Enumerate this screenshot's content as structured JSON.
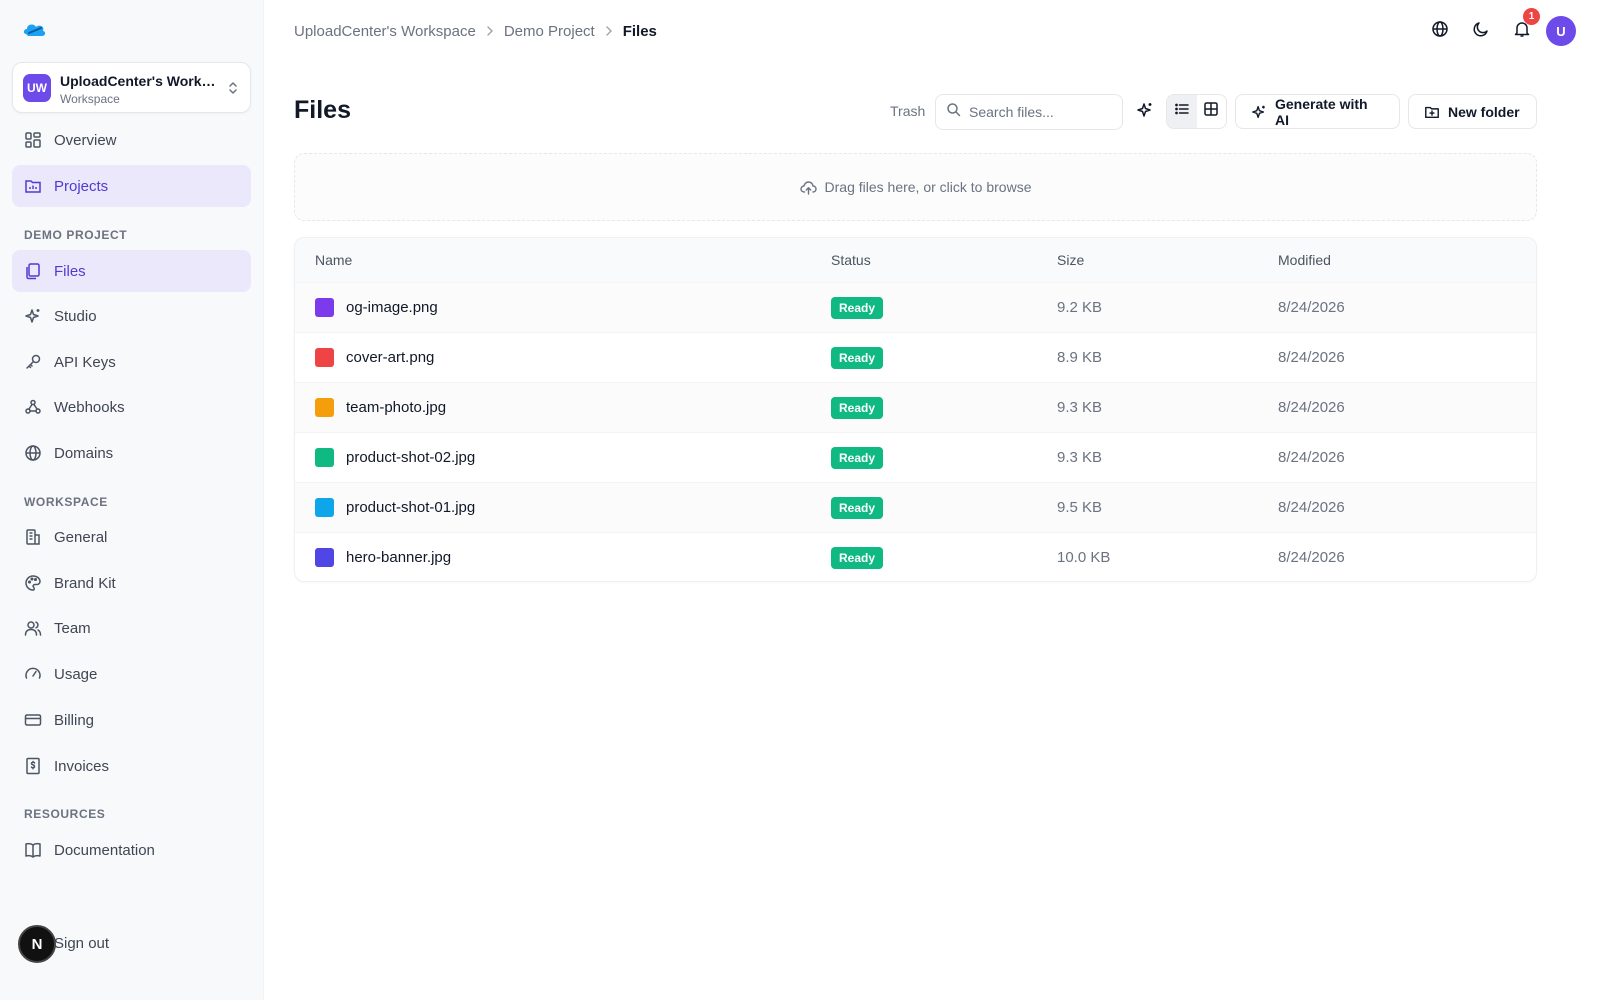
{
  "workspace": {
    "initials": "UW",
    "name": "UploadCenter's Workspace",
    "type": "Workspace"
  },
  "nav_top": [
    {
      "label": "Overview",
      "icon": "grid-icon"
    },
    {
      "label": "Projects",
      "icon": "folder-chart-icon",
      "active": true
    }
  ],
  "sections": {
    "project": "DEMO PROJECT",
    "workspace": "WORKSPACE",
    "resources": "RESOURCES"
  },
  "nav_project": [
    {
      "label": "Files",
      "icon": "files-icon",
      "active": true
    },
    {
      "label": "Studio",
      "icon": "sparkles-icon"
    },
    {
      "label": "API Keys",
      "icon": "key-icon"
    },
    {
      "label": "Webhooks",
      "icon": "webhook-icon"
    },
    {
      "label": "Domains",
      "icon": "globe-icon"
    }
  ],
  "nav_workspace": [
    {
      "label": "General",
      "icon": "building-icon"
    },
    {
      "label": "Brand Kit",
      "icon": "palette-icon"
    },
    {
      "label": "Team",
      "icon": "users-icon"
    },
    {
      "label": "Usage",
      "icon": "gauge-icon"
    },
    {
      "label": "Billing",
      "icon": "credit-card-icon"
    },
    {
      "label": "Invoices",
      "icon": "receipt-icon"
    }
  ],
  "nav_resources": [
    {
      "label": "Documentation",
      "icon": "book-icon"
    }
  ],
  "signout_label": "Sign out",
  "badge_letter": "N",
  "breadcrumb": {
    "workspace": "UploadCenter's Workspace",
    "project": "Demo Project",
    "current": "Files"
  },
  "topbar": {
    "notifications": "1",
    "user_initial": "U"
  },
  "header": {
    "title": "Files",
    "trash": "Trash",
    "search_placeholder": "Search files...",
    "generate_label": "Generate with AI",
    "new_folder_label": "New folder"
  },
  "dropzone": {
    "text": "Drag files here, or click to browse"
  },
  "table": {
    "columns": [
      "Name",
      "Status",
      "Size",
      "Modified"
    ],
    "rows": [
      {
        "name": "og-image.png",
        "color": "#7c3aed",
        "status": "Ready",
        "size": "9.2 KB",
        "modified": "8/24/2026"
      },
      {
        "name": "cover-art.png",
        "color": "#ef4444",
        "status": "Ready",
        "size": "8.9 KB",
        "modified": "8/24/2026"
      },
      {
        "name": "team-photo.jpg",
        "color": "#f59e0b",
        "status": "Ready",
        "size": "9.3 KB",
        "modified": "8/24/2026"
      },
      {
        "name": "product-shot-02.jpg",
        "color": "#10b981",
        "status": "Ready",
        "size": "9.3 KB",
        "modified": "8/24/2026"
      },
      {
        "name": "product-shot-01.jpg",
        "color": "#0ea5e9",
        "status": "Ready",
        "size": "9.5 KB",
        "modified": "8/24/2026"
      },
      {
        "name": "hero-banner.jpg",
        "color": "#4f46e5",
        "status": "Ready",
        "size": "10.0 KB",
        "modified": "8/24/2026"
      }
    ]
  },
  "colors": {
    "accent": "#6d4aea",
    "active_bg": "#ebe8fc",
    "ready": "#10b981",
    "danger": "#ef4444"
  }
}
